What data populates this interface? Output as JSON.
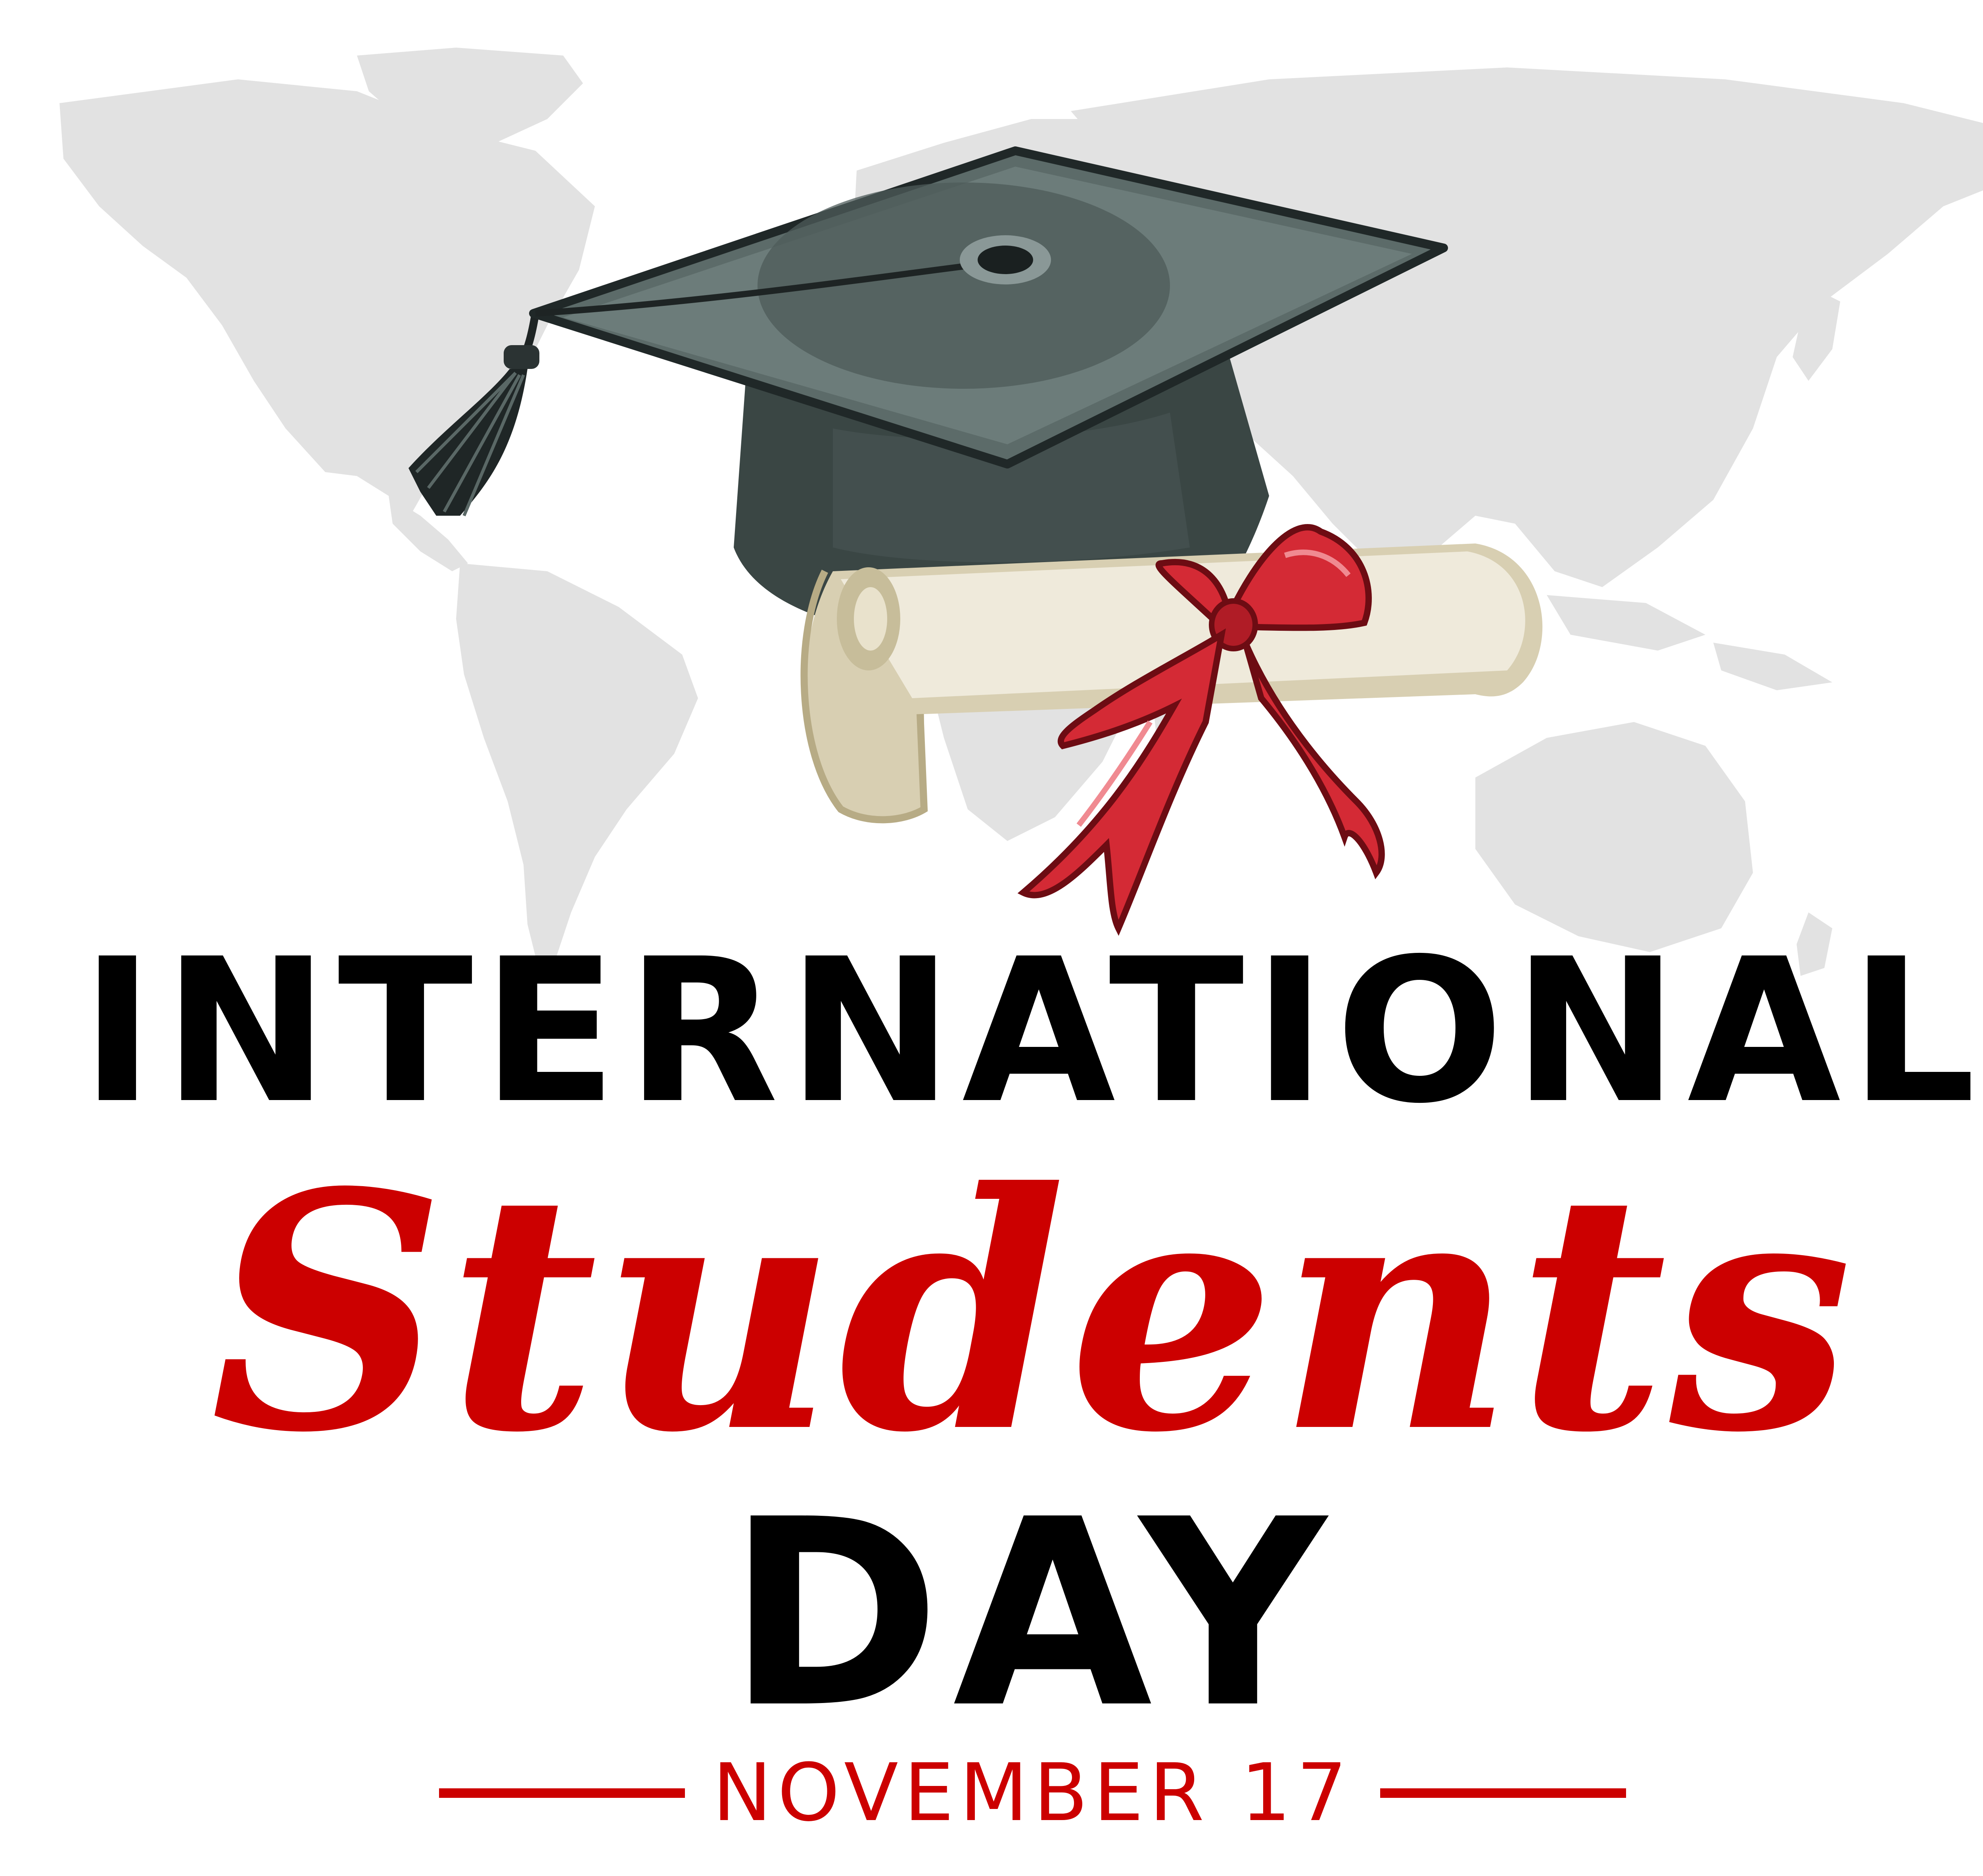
{
  "headline": {
    "line1": "INTERNATIONAL",
    "line2": "Students",
    "line3": "DAY"
  },
  "date": "NOVEMBER 17",
  "colors": {
    "background": "#ffffff",
    "map": "#e2e2e2",
    "text_dark": "#000000",
    "accent_red": "#cc0000",
    "cap_dark": "#3a4644",
    "cap_top": "#5a6866",
    "diploma": "#efeadb",
    "ribbon": "#d42a35"
  },
  "icons": {
    "background": "world-map-icon",
    "cap": "graduation-cap-icon",
    "tassel": "tassel-icon",
    "scroll": "diploma-scroll-icon",
    "bow": "ribbon-bow-icon"
  }
}
